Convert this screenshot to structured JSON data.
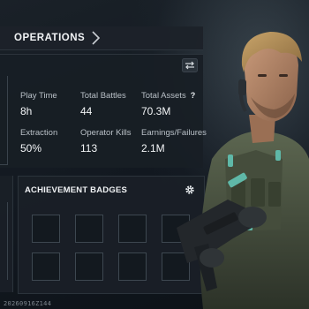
{
  "header": {
    "title": "OPERATIONS",
    "chevron_icon": "chevron-right-icon",
    "settings_icon": "swap-settings-icon"
  },
  "stats": {
    "play_time": {
      "label": "Play Time",
      "value": "8h"
    },
    "total_battles": {
      "label": "Total Battles",
      "value": "44"
    },
    "total_assets": {
      "label": "Total Assets",
      "value": "70.3M",
      "help": "?"
    },
    "extraction": {
      "label": "Extraction",
      "value": "50%"
    },
    "operator_kills": {
      "label": "Operator Kills",
      "value": "113"
    },
    "earnings_failures": {
      "label": "Earnings/Failures",
      "value": "2.1M"
    }
  },
  "achievements": {
    "title": "ACHIEVEMENT BADGES",
    "gear_icon": "gear-icon",
    "slot_count": 8
  },
  "footer": {
    "build_id": "20260916Z144"
  },
  "character": {
    "icon": "operator-portrait"
  },
  "colors": {
    "panel": "#181e25",
    "border": "#2c343c",
    "text": "#f3f5f7",
    "muted_text": "#b9c0c7"
  }
}
